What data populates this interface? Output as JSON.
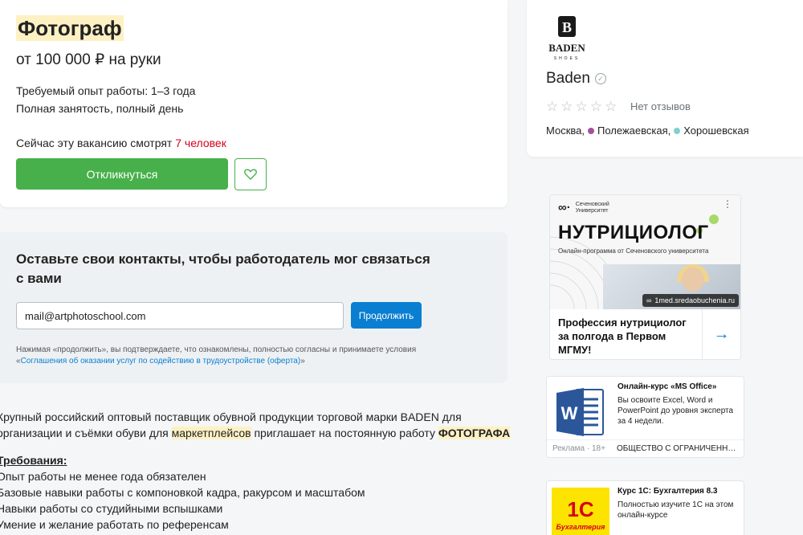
{
  "vacancy": {
    "title": "Фотограф",
    "salary": "от 100 000 ₽ на руки",
    "experience": "Требуемый опыт работы: 1–3 года",
    "employment": "Полная занятость, полный день",
    "viewers_prefix": "Сейчас эту вакансию смотрят",
    "viewers_count": "7 человек",
    "apply_label": "Откликнуться",
    "favorite_icon": "heart-icon"
  },
  "contacts": {
    "title": "Оставьте свои контакты, чтобы работодатель мог связаться с вами",
    "email_value": "mail@artphotoschool.com",
    "continue_label": "Продолжить",
    "consent_text": "Нажимая «продолжить», вы подтверждаете, что ознакомлены, полностью согласны и принимаете условия",
    "consent_open_quote": "«",
    "consent_link": "Соглашения об оказании услуг по содействию в трудоустройстве (оферта)",
    "consent_close_quote": "»"
  },
  "description": {
    "intro_part1": "Крупный российский оптовый поставщик обувной продукции торговой марки BADEN для организации и съёмки обуви для",
    "intro_highlight": "маркетплейсов",
    "intro_part2": "приглашает на постоянную работу",
    "intro_bold": "ФОТОГРАФА",
    "requirements_heading": "Требования:",
    "requirements": [
      "Опыт работы не менее года обязателен",
      "Базовые навыки работы с компоновкой кадра, ракурсом и масштабом",
      "Навыки работы со студийными вспышками",
      "Умение и желание работать по референсам"
    ]
  },
  "employer": {
    "logo_text": "BADEN",
    "logo_sub": "SHOES",
    "name": "Baden",
    "verified_icon": "check-circle-icon",
    "rating_stars": 0,
    "reviews_label": "Нет отзывов",
    "city": "Москва,",
    "metro": [
      {
        "name": "Полежаевская,",
        "color": "#a2529c"
      },
      {
        "name": "Хорошевская",
        "color": "#7fd1cf"
      }
    ]
  },
  "ads": {
    "nutri": {
      "brand_text": "Сеченовский Университет",
      "headline": "НУТРИЦИОЛОГ",
      "subline": "Онлайн-программа от Сеченовского университета",
      "domain": "1med.sredaobuchenia.ru",
      "title": "Профессия нутрициолог за полгода в Первом МГМУ!",
      "menu_icon": "more-vertical-icon",
      "arrow_icon": "arrow-right-icon"
    },
    "office": {
      "title": "Онлайн-курс «MS Office»",
      "text": "Вы освоите Excel, Word и PowerPoint до уровня эксперта за 4 недели.",
      "ad_label": "Реклама · 18+",
      "company": "ОБЩЕСТВО С ОГРАНИЧЕННОЙ ОТВЕТСТВЕННОСТЬЮ"
    },
    "onec": {
      "title": "Курс 1С: Бухгалтерия 8.3",
      "text": "Полностью изучите 1С на этом онлайн-курсе",
      "logo_main": "1С",
      "logo_sub": "Бухгалтерия"
    }
  }
}
